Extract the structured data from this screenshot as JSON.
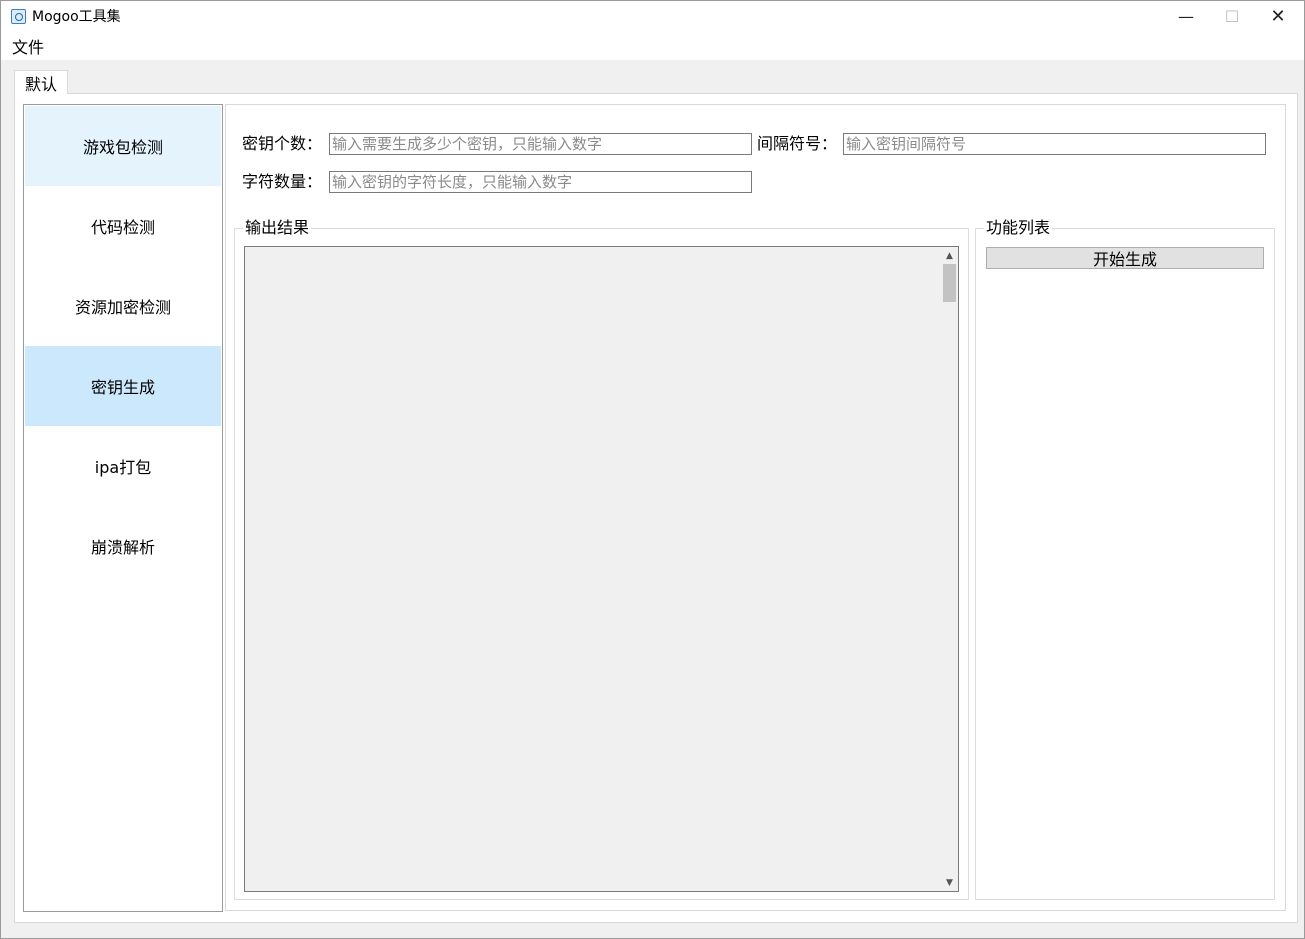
{
  "window": {
    "title": "Mogoo工具集",
    "minimize_glyph": "—",
    "maximize_glyph": "☐",
    "close_glyph": "✕"
  },
  "menu": {
    "items": [
      {
        "label": "文件"
      }
    ]
  },
  "tabs": [
    {
      "label": "默认",
      "active": true
    }
  ],
  "nav": {
    "items": [
      {
        "label": "游戏包检测",
        "state": "hover"
      },
      {
        "label": "代码检测"
      },
      {
        "label": "资源加密检测"
      },
      {
        "label": "密钥生成",
        "state": "selected"
      },
      {
        "label": "ipa打包"
      },
      {
        "label": "崩溃解析"
      }
    ]
  },
  "form": {
    "key_count": {
      "label": "密钥个数：",
      "value": "",
      "placeholder": "输入需要生成多少个密钥，只能输入数字"
    },
    "separator": {
      "label": "间隔符号：",
      "value": "",
      "placeholder": "输入密钥间隔符号"
    },
    "char_count": {
      "label": "字符数量：",
      "value": "",
      "placeholder": "输入密钥的字符长度，只能输入数字"
    }
  },
  "output": {
    "title": "输出结果",
    "text": ""
  },
  "functions": {
    "title": "功能列表",
    "buttons": [
      {
        "label": "开始生成"
      }
    ]
  },
  "icons": {
    "app": "app-icon",
    "scroll_up": "chevron-up-icon",
    "scroll_down": "chevron-down-icon"
  },
  "colors": {
    "nav_hover": "#e5f3fd",
    "nav_selected": "#cce8fc",
    "window_bg": "#f0f0f0",
    "button_bg": "#e1e1e1"
  }
}
